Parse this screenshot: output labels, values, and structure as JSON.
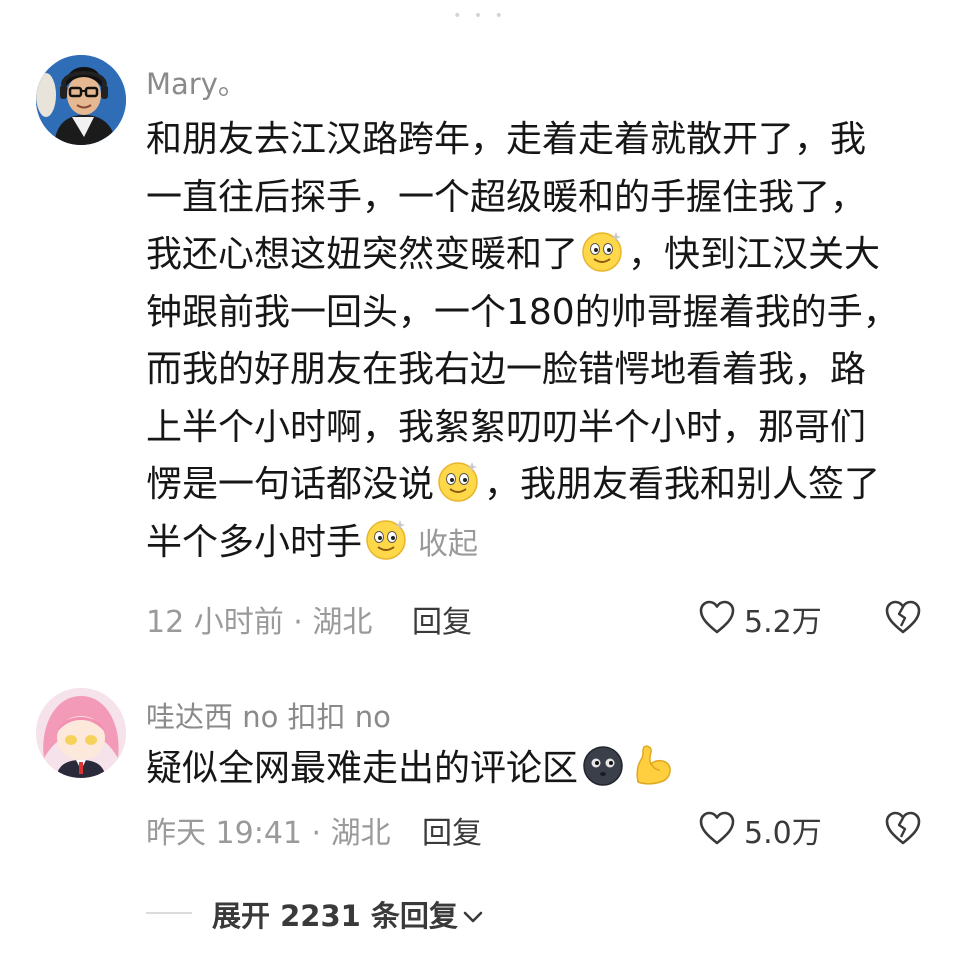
{
  "comments": [
    {
      "username": "Mary。",
      "lines": [
        [
          "和朋友去江汉路跨年，走着走着就散开了，我"
        ],
        [
          "一直往后探手，一个超级暖和的手握住我了，"
        ],
        [
          "我还心想这妞突然变暖和了",
          "，快到江汉关大"
        ],
        [
          "钟跟前我一回头，一个180的帅哥握着我的手，"
        ],
        [
          "而我的好朋友在我右边一脸错愕地看着我，路"
        ],
        [
          "上半个小时啊，我絮絮叨叨半个小时，那哥们"
        ],
        [
          "愣是一句话都没说",
          "，我朋友看我和别人签了"
        ],
        [
          "半个多小时手",
          ""
        ]
      ],
      "collapse_label": "收起",
      "meta": "12 小时前 · 湖北",
      "reply_label": "回复",
      "likes": "5.2万"
    },
    {
      "username": "哇达西 no 扣扣 no",
      "text": "疑似全网最难走出的评论区",
      "meta": "昨天 19:41 · 湖北",
      "reply_label": "回复",
      "likes": "5.0万"
    }
  ],
  "expand_label": "展开 2231 条回复",
  "icons": {
    "emoji_1": "smiling-face-icon",
    "emoji_2": "dark-face-icon",
    "emoji_3": "flexed-biceps-icon",
    "like": "heart-icon",
    "dislike": "broken-heart-icon",
    "expand": "chevron-down-icon"
  },
  "colors": {
    "text": "#161616",
    "muted": "#9a9a9a",
    "action": "#3a3a3a"
  }
}
